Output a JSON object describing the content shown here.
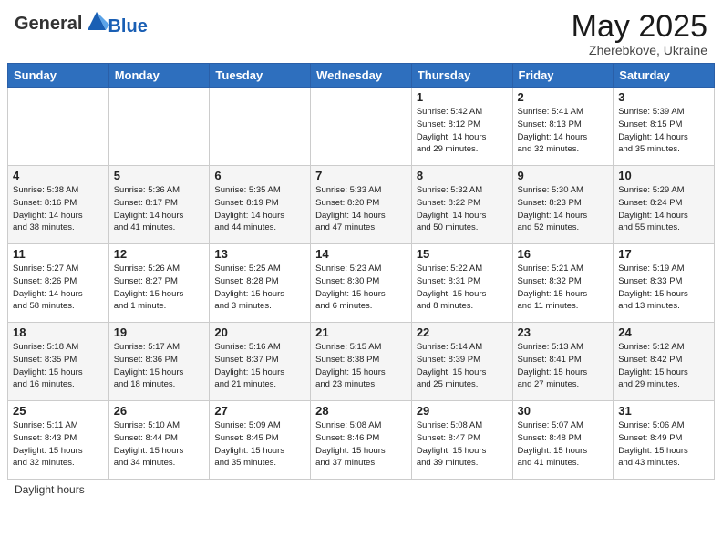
{
  "header": {
    "logo_general": "General",
    "logo_blue": "Blue",
    "month_year": "May 2025",
    "location": "Zherebkove, Ukraine"
  },
  "calendar": {
    "days_of_week": [
      "Sunday",
      "Monday",
      "Tuesday",
      "Wednesday",
      "Thursday",
      "Friday",
      "Saturday"
    ],
    "weeks": [
      [
        {
          "day": "",
          "info": ""
        },
        {
          "day": "",
          "info": ""
        },
        {
          "day": "",
          "info": ""
        },
        {
          "day": "",
          "info": ""
        },
        {
          "day": "1",
          "info": "Sunrise: 5:42 AM\nSunset: 8:12 PM\nDaylight: 14 hours\nand 29 minutes."
        },
        {
          "day": "2",
          "info": "Sunrise: 5:41 AM\nSunset: 8:13 PM\nDaylight: 14 hours\nand 32 minutes."
        },
        {
          "day": "3",
          "info": "Sunrise: 5:39 AM\nSunset: 8:15 PM\nDaylight: 14 hours\nand 35 minutes."
        }
      ],
      [
        {
          "day": "4",
          "info": "Sunrise: 5:38 AM\nSunset: 8:16 PM\nDaylight: 14 hours\nand 38 minutes."
        },
        {
          "day": "5",
          "info": "Sunrise: 5:36 AM\nSunset: 8:17 PM\nDaylight: 14 hours\nand 41 minutes."
        },
        {
          "day": "6",
          "info": "Sunrise: 5:35 AM\nSunset: 8:19 PM\nDaylight: 14 hours\nand 44 minutes."
        },
        {
          "day": "7",
          "info": "Sunrise: 5:33 AM\nSunset: 8:20 PM\nDaylight: 14 hours\nand 47 minutes."
        },
        {
          "day": "8",
          "info": "Sunrise: 5:32 AM\nSunset: 8:22 PM\nDaylight: 14 hours\nand 50 minutes."
        },
        {
          "day": "9",
          "info": "Sunrise: 5:30 AM\nSunset: 8:23 PM\nDaylight: 14 hours\nand 52 minutes."
        },
        {
          "day": "10",
          "info": "Sunrise: 5:29 AM\nSunset: 8:24 PM\nDaylight: 14 hours\nand 55 minutes."
        }
      ],
      [
        {
          "day": "11",
          "info": "Sunrise: 5:27 AM\nSunset: 8:26 PM\nDaylight: 14 hours\nand 58 minutes."
        },
        {
          "day": "12",
          "info": "Sunrise: 5:26 AM\nSunset: 8:27 PM\nDaylight: 15 hours\nand 1 minute."
        },
        {
          "day": "13",
          "info": "Sunrise: 5:25 AM\nSunset: 8:28 PM\nDaylight: 15 hours\nand 3 minutes."
        },
        {
          "day": "14",
          "info": "Sunrise: 5:23 AM\nSunset: 8:30 PM\nDaylight: 15 hours\nand 6 minutes."
        },
        {
          "day": "15",
          "info": "Sunrise: 5:22 AM\nSunset: 8:31 PM\nDaylight: 15 hours\nand 8 minutes."
        },
        {
          "day": "16",
          "info": "Sunrise: 5:21 AM\nSunset: 8:32 PM\nDaylight: 15 hours\nand 11 minutes."
        },
        {
          "day": "17",
          "info": "Sunrise: 5:19 AM\nSunset: 8:33 PM\nDaylight: 15 hours\nand 13 minutes."
        }
      ],
      [
        {
          "day": "18",
          "info": "Sunrise: 5:18 AM\nSunset: 8:35 PM\nDaylight: 15 hours\nand 16 minutes."
        },
        {
          "day": "19",
          "info": "Sunrise: 5:17 AM\nSunset: 8:36 PM\nDaylight: 15 hours\nand 18 minutes."
        },
        {
          "day": "20",
          "info": "Sunrise: 5:16 AM\nSunset: 8:37 PM\nDaylight: 15 hours\nand 21 minutes."
        },
        {
          "day": "21",
          "info": "Sunrise: 5:15 AM\nSunset: 8:38 PM\nDaylight: 15 hours\nand 23 minutes."
        },
        {
          "day": "22",
          "info": "Sunrise: 5:14 AM\nSunset: 8:39 PM\nDaylight: 15 hours\nand 25 minutes."
        },
        {
          "day": "23",
          "info": "Sunrise: 5:13 AM\nSunset: 8:41 PM\nDaylight: 15 hours\nand 27 minutes."
        },
        {
          "day": "24",
          "info": "Sunrise: 5:12 AM\nSunset: 8:42 PM\nDaylight: 15 hours\nand 29 minutes."
        }
      ],
      [
        {
          "day": "25",
          "info": "Sunrise: 5:11 AM\nSunset: 8:43 PM\nDaylight: 15 hours\nand 32 minutes."
        },
        {
          "day": "26",
          "info": "Sunrise: 5:10 AM\nSunset: 8:44 PM\nDaylight: 15 hours\nand 34 minutes."
        },
        {
          "day": "27",
          "info": "Sunrise: 5:09 AM\nSunset: 8:45 PM\nDaylight: 15 hours\nand 35 minutes."
        },
        {
          "day": "28",
          "info": "Sunrise: 5:08 AM\nSunset: 8:46 PM\nDaylight: 15 hours\nand 37 minutes."
        },
        {
          "day": "29",
          "info": "Sunrise: 5:08 AM\nSunset: 8:47 PM\nDaylight: 15 hours\nand 39 minutes."
        },
        {
          "day": "30",
          "info": "Sunrise: 5:07 AM\nSunset: 8:48 PM\nDaylight: 15 hours\nand 41 minutes."
        },
        {
          "day": "31",
          "info": "Sunrise: 5:06 AM\nSunset: 8:49 PM\nDaylight: 15 hours\nand 43 minutes."
        }
      ]
    ]
  },
  "footer": {
    "text": "Daylight hours"
  }
}
